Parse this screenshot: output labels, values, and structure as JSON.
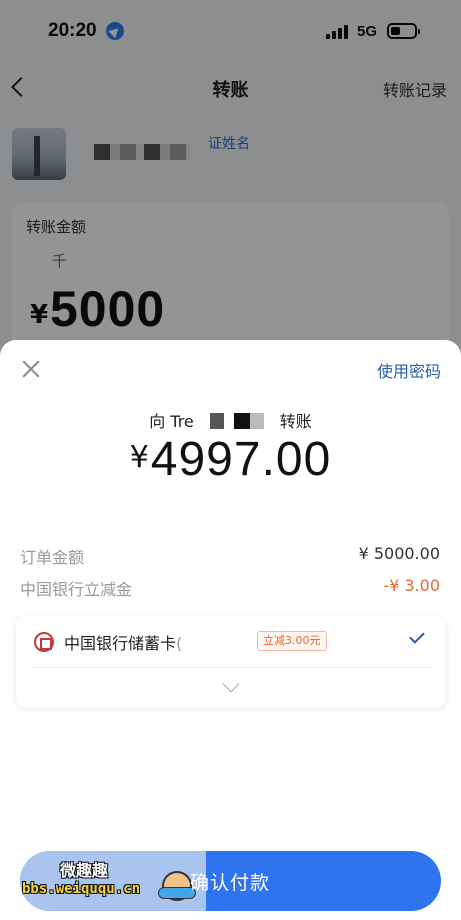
{
  "status_bar": {
    "time": "20:20",
    "network": "5G"
  },
  "nav": {
    "title": "转账",
    "records": "转账记录"
  },
  "payee": {
    "verify_link": "证姓名"
  },
  "amount_card": {
    "label": "转账金额",
    "unit": "千",
    "symbol": "¥",
    "value": "5000"
  },
  "sheet": {
    "use_password": "使用密码",
    "payee_prefix": "向 Tre",
    "payee_suffix": "转账",
    "amount_symbol": "¥",
    "amount": "4997.00",
    "details": [
      {
        "label": "订单金额",
        "value": "¥ 5000.00"
      },
      {
        "label": "中国银行立减金",
        "value": "-¥ 3.00"
      }
    ],
    "method": {
      "name": "中国银行储蓄卡",
      "tail": "(",
      "promo": "立减3.00元"
    },
    "confirm_label": "确认付款"
  },
  "watermark": {
    "title": "微趣趣",
    "url": "bbs.weiququ.cn"
  },
  "colors": {
    "accent": "#2f74ee",
    "discount": "#e5683a",
    "link": "#2b5fa8"
  }
}
